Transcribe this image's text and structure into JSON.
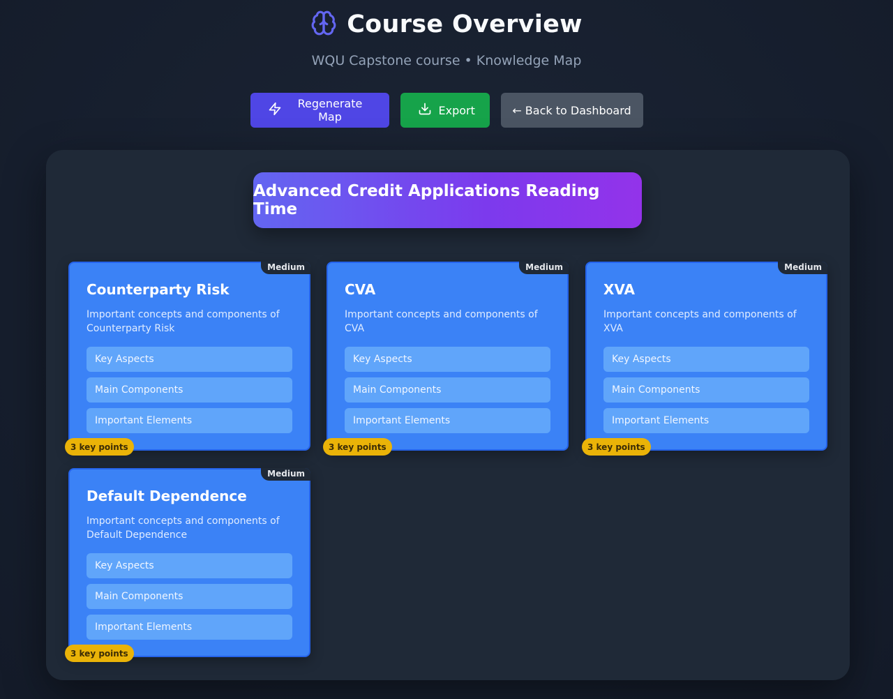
{
  "header": {
    "title": "Course Overview",
    "subtitle": "WQU Capstone course • Knowledge Map"
  },
  "toolbar": {
    "regenerate_label": "Regenerate Map",
    "export_label": "Export",
    "back_label": "← Back to Dashboard"
  },
  "map": {
    "root": "Advanced Credit Applications Reading Time",
    "topics": [
      {
        "title": "Counterparty Risk",
        "description": "Important concepts and components of Counterparty Risk",
        "difficulty": "Medium",
        "aspects": [
          "Key Aspects",
          "Main Components",
          "Important Elements"
        ],
        "key_points": "3 key points"
      },
      {
        "title": "CVA",
        "description": "Important concepts and components of CVA",
        "difficulty": "Medium",
        "aspects": [
          "Key Aspects",
          "Main Components",
          "Important Elements"
        ],
        "key_points": "3 key points"
      },
      {
        "title": "XVA",
        "description": "Important concepts and components of XVA",
        "difficulty": "Medium",
        "aspects": [
          "Key Aspects",
          "Main Components",
          "Important Elements"
        ],
        "key_points": "3 key points"
      },
      {
        "title": "Default Dependence",
        "description": "Important concepts and components of Default Dependence",
        "difficulty": "Medium",
        "aspects": [
          "Key Aspects",
          "Main Components",
          "Important Elements"
        ],
        "key_points": "3 key points"
      }
    ]
  },
  "colors": {
    "background": "#161e2e",
    "panel": "#1f2937",
    "card": "#3b82f6",
    "aspect": "#60a5fa",
    "badge_keys": "#eab308",
    "regenerate": "#4f46e5",
    "export": "#16a34a",
    "back": "#4b5563",
    "brain_icon": "#6366f1"
  },
  "icons": {
    "title": "brain-icon",
    "regenerate": "lightning-icon",
    "export": "download-icon"
  }
}
